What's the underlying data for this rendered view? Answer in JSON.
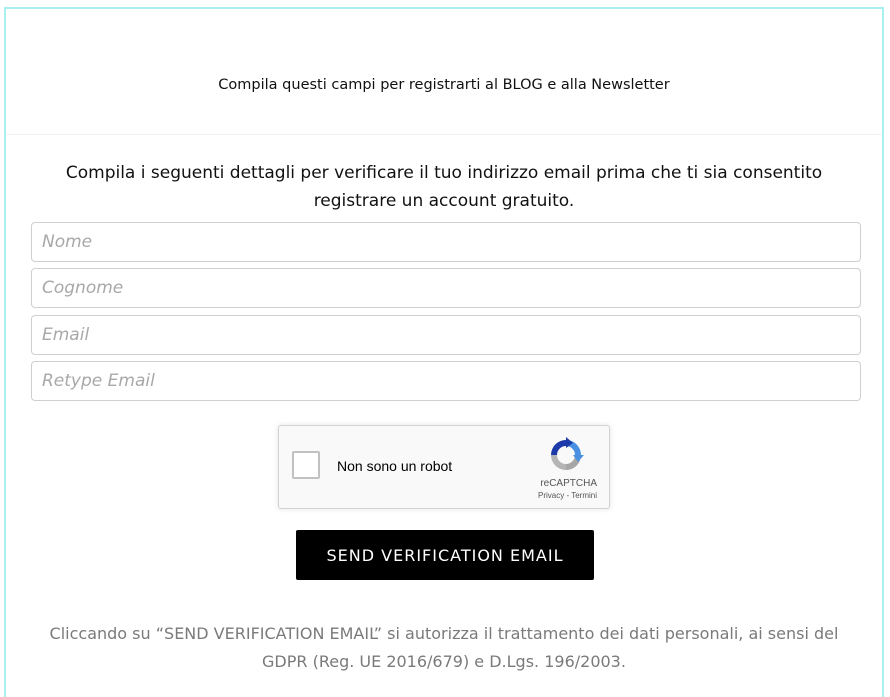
{
  "header": {
    "text": "Compila questi campi per registrarti al BLOG e alla Newsletter"
  },
  "intro": {
    "text": "Compila i seguenti dettagli per verificare il tuo indirizzo email prima che ti sia consentito registrare un account gratuito."
  },
  "form": {
    "first_name_placeholder": "Nome",
    "last_name_placeholder": "Cognome",
    "email_placeholder": "Email",
    "retype_email_placeholder": "Retype Email"
  },
  "recaptcha": {
    "label": "Non sono un robot",
    "brand": "reCAPTCHA",
    "privacy": "Privacy",
    "separator": " - ",
    "terms": "Termini",
    "checked": false
  },
  "send_button": {
    "label": "SEND VERIFICATION EMAIL"
  },
  "consent": {
    "text": "Cliccando su “SEND VERIFICATION EMAIL” si autorizza il trattamento dei dati personali, ai sensi del GDPR (Reg. UE 2016/679) e D.Lgs. 196/2003."
  },
  "colors": {
    "frame_border": "#a9f0f2",
    "button_bg": "#000000",
    "button_text": "#ffffff",
    "consent_text": "#7a7a7a"
  }
}
